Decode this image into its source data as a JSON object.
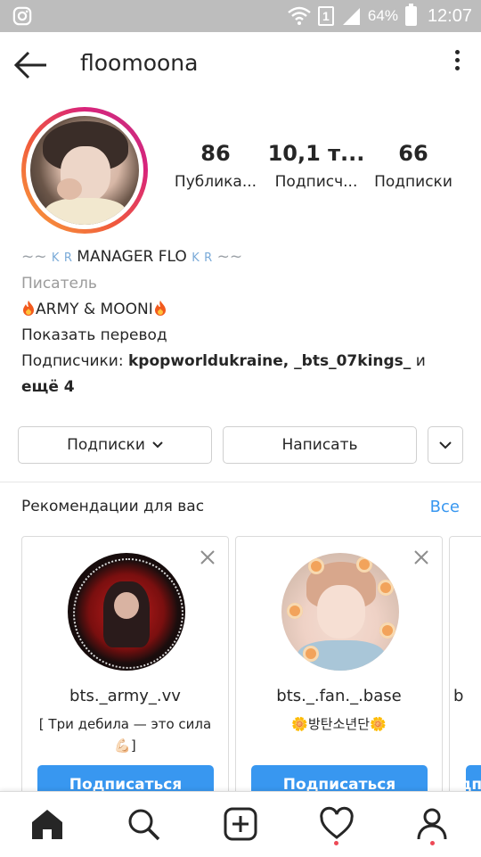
{
  "status_bar": {
    "sim_number": "1",
    "battery": "64%",
    "time": "12:07"
  },
  "header": {
    "username": "floomoona"
  },
  "stats": [
    {
      "value": "86",
      "label": "Публика..."
    },
    {
      "value": "10,1 т...",
      "label": "Подписч..."
    },
    {
      "value": "66",
      "label": "Подписки"
    }
  ],
  "bio": {
    "name_prefix": "~~",
    "name_deco_1": "K",
    "name_deco_2": "R",
    "name": "MANAGER FLO",
    "name_suffix": "~~",
    "category": "Писатель",
    "line1": "ARMY & MOONI",
    "translate": "Показать перевод",
    "followers_prefix": "Подписчики:",
    "followers_names": "kpopworldukraine, _bts_07kings_",
    "followers_and": "и",
    "followers_more": "ещё 4"
  },
  "buttons": {
    "following": "Подписки",
    "message": "Написать"
  },
  "recommendations": {
    "title": "Рекомендации для вас",
    "see_all": "Все",
    "cards": [
      {
        "name": "bts._army_.vv",
        "desc": "[ Три дебила — это сила 💪🏻]",
        "follow": "Подписаться"
      },
      {
        "name": "bts._.fan._.base",
        "desc": "🌼방탄소년단🌼",
        "follow": "Подписаться"
      },
      {
        "name": "b",
        "desc": "",
        "follow": "Подписаться"
      }
    ]
  },
  "colors": {
    "accent": "#3897f0",
    "notification_dot": "#ed4956"
  },
  "icons": [
    "instagram-icon",
    "wifi-icon",
    "signal-icon",
    "battery-icon",
    "back-arrow-icon",
    "more-vertical-icon",
    "fire-icon",
    "chevron-down-icon",
    "close-icon",
    "home-icon",
    "search-icon",
    "add-post-icon",
    "heart-icon",
    "profile-icon"
  ]
}
